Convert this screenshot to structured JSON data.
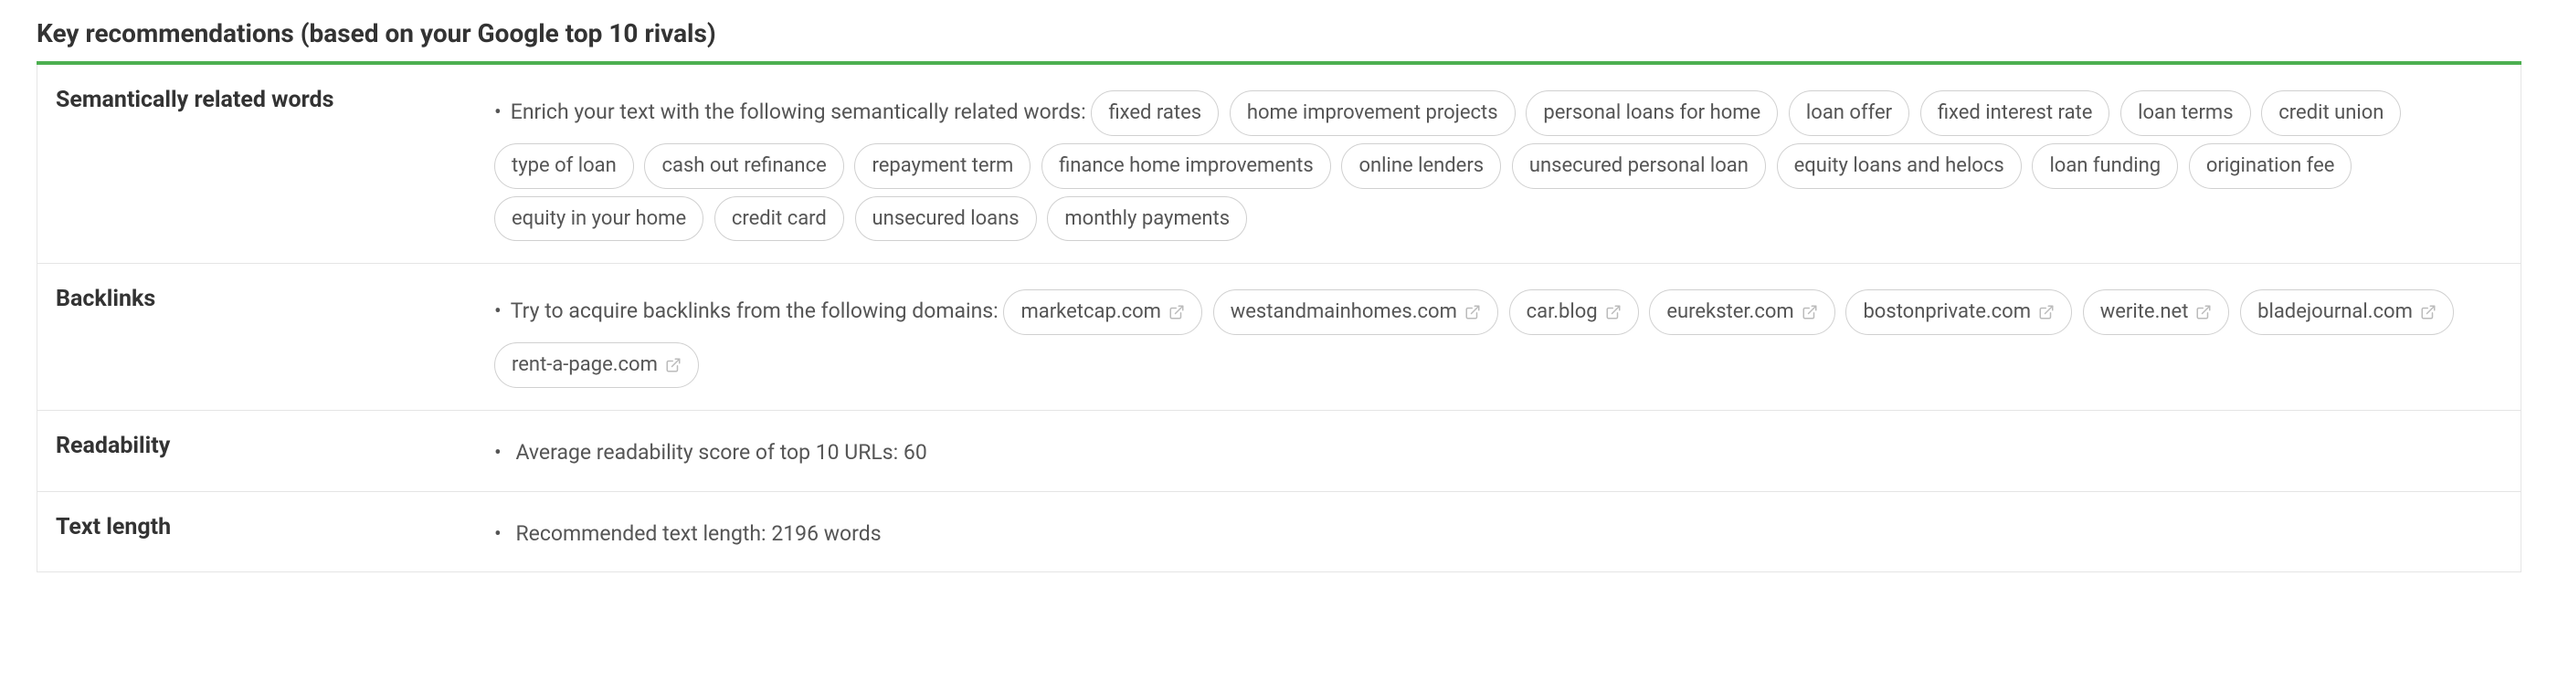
{
  "title": "Key recommendations (based on your Google top 10 rivals)",
  "rows": {
    "semantic": {
      "label": "Semantically related words",
      "lede": "Enrich your text with the following semantically related words:",
      "chips": [
        "fixed rates",
        "home improvement projects",
        "personal loans for home",
        "loan offer",
        "fixed interest rate",
        "loan terms",
        "credit union",
        "type of loan",
        "cash out refinance",
        "repayment term",
        "finance home improvements",
        "online lenders",
        "unsecured personal loan",
        "equity loans and helocs",
        "loan funding",
        "origination fee",
        "equity in your home",
        "credit card",
        "unsecured loans",
        "monthly payments"
      ]
    },
    "backlinks": {
      "label": "Backlinks",
      "lede": "Try to acquire backlinks from the following domains:",
      "chips": [
        "marketcap.com",
        "westandmainhomes.com",
        "car.blog",
        "eurekster.com",
        "bostonprivate.com",
        "werite.net",
        "bladejournal.com",
        "rent-a-page.com"
      ]
    },
    "readability": {
      "label": "Readability",
      "text_prefix": "Average readability score of top 10 URLs:  ",
      "value": "60"
    },
    "textlength": {
      "label": "Text length",
      "text_prefix": "Recommended text length:  ",
      "value": "2196 words"
    }
  }
}
